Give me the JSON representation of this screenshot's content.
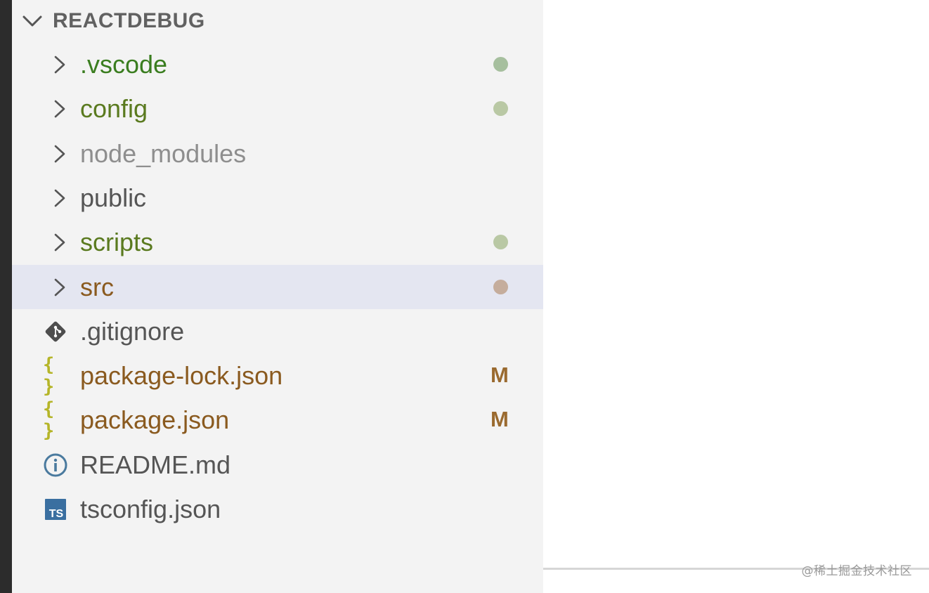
{
  "explorer": {
    "section_title": "REACTDEBUG",
    "items": [
      {
        "name": ".vscode",
        "kind": "folder",
        "label_color": "#3a7d1f",
        "decoration": "dot",
        "decoration_color": "#a6bf9e"
      },
      {
        "name": "config",
        "kind": "folder",
        "label_color": "#5a7a1f",
        "decoration": "dot",
        "decoration_color": "#b9c8a4"
      },
      {
        "name": "node_modules",
        "kind": "folder",
        "label_color": "#8e8e8e",
        "decoration": "none"
      },
      {
        "name": "public",
        "kind": "folder",
        "label_color": "#555555",
        "decoration": "none"
      },
      {
        "name": "scripts",
        "kind": "folder",
        "label_color": "#5a7a1f",
        "decoration": "dot",
        "decoration_color": "#b9c8a4"
      },
      {
        "name": "src",
        "kind": "folder",
        "label_color": "#8a5a1f",
        "decoration": "dot",
        "decoration_color": "#c5ad9c",
        "selected": true
      },
      {
        "name": ".gitignore",
        "kind": "file",
        "icon": "git-icon",
        "label_color": "#555555",
        "decoration": "none"
      },
      {
        "name": "package-lock.json",
        "kind": "file",
        "icon": "json-icon",
        "label_color": "#8a5a1f",
        "decoration": "text",
        "decoration_text": "M",
        "decoration_color": "#9a6a2f"
      },
      {
        "name": "package.json",
        "kind": "file",
        "icon": "json-icon",
        "label_color": "#8a5a1f",
        "decoration": "text",
        "decoration_text": "M",
        "decoration_color": "#9a6a2f"
      },
      {
        "name": "README.md",
        "kind": "file",
        "icon": "info-icon",
        "label_color": "#555555",
        "decoration": "none"
      },
      {
        "name": "tsconfig.json",
        "kind": "file",
        "icon": "typescript-icon",
        "label_color": "#555555",
        "decoration": "none"
      }
    ]
  },
  "watermark": "@稀土掘金技术社区"
}
